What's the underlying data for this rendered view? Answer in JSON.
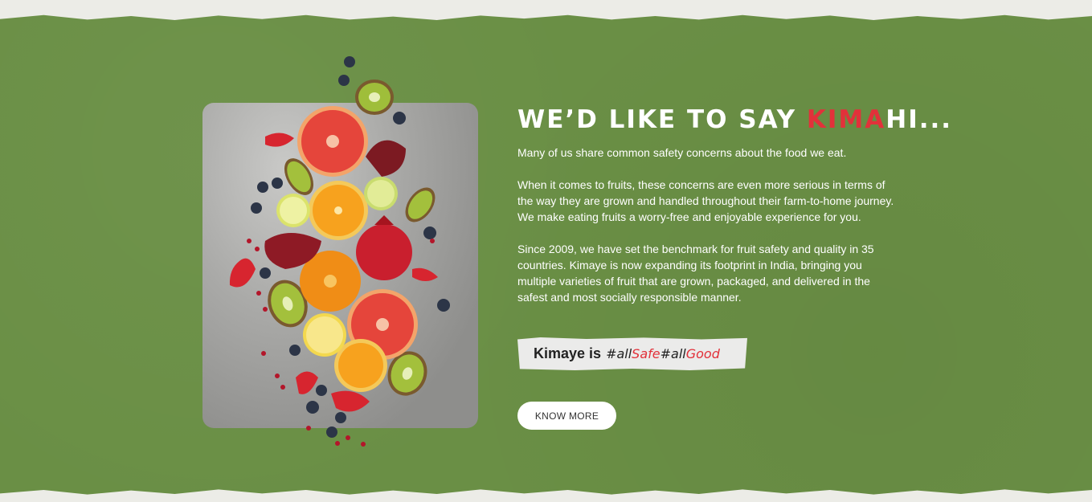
{
  "section": {
    "headline_prefix": "WE’D LIKE TO SAY ",
    "headline_accent": "KIMA",
    "headline_suffix": "HI...",
    "paragraphs": [
      "Many of us share common safety concerns about the food we eat.",
      "When it comes to fruits, these concerns are even more serious in terms of the way they are grown and handled throughout their farm-to-home journey. We make eating fruits a worry-free and enjoyable experience for you.",
      "Since 2009, we have set the benchmark for fruit safety and quality in 35 countries. Kimaye is now expanding its footprint in India, bringing you multiple varieties of fruit that are grown, packaged, and delivered in the safest and most socially responsible manner."
    ],
    "tagline": {
      "lead": "Kimaye is",
      "hash1": "#all",
      "word1": "Safe",
      "hash2": "#all",
      "word2": "Good"
    },
    "cta_label": "KNOW MORE"
  },
  "image": {
    "description_icon": "fruit-photo"
  },
  "colors": {
    "band_green": "#6a8f45",
    "accent_red": "#e2313a",
    "paper": "#ecece7"
  }
}
